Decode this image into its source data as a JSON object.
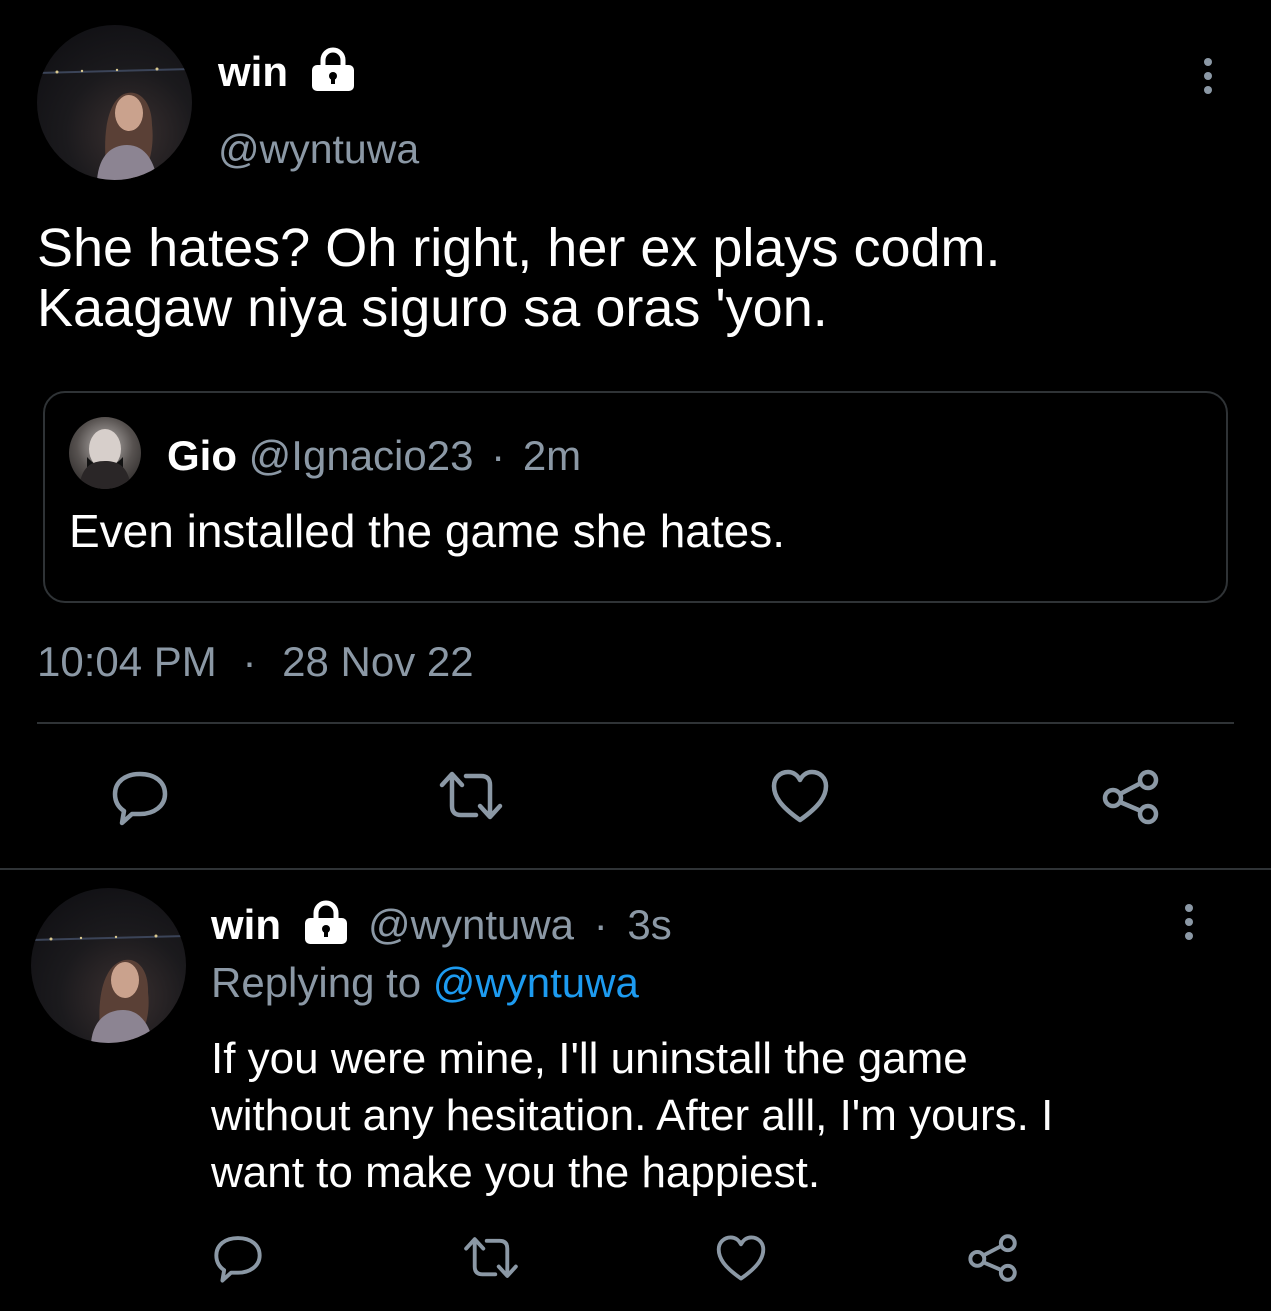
{
  "main_tweet": {
    "display_name": "win",
    "handle": "@wyntuwa",
    "text_line1": "She hates? Oh right, her ex plays codm.",
    "text_line2": "Kaagaw niya siguro sa oras 'yon.",
    "time": "10:04 PM",
    "separator": "·",
    "date": "28 Nov 22",
    "lock_icon": "lock-icon",
    "quoted": {
      "display_name": "Gio",
      "handle": "@Ignacio23",
      "separator": "·",
      "age": "2m",
      "text": "Even installed the game she hates."
    }
  },
  "reply_tweet": {
    "display_name": "win",
    "handle": "@wyntuwa",
    "separator": "·",
    "age": "3s",
    "replying_prefix": "Replying to",
    "replying_handle": "@wyntuwa",
    "text_line1": "If you were mine, I'll uninstall the game",
    "text_line2": "without any hesitation. After alll, I'm yours. I",
    "text_line3": "want to make you the happiest."
  },
  "actions": [
    "reply-icon",
    "retweet-icon",
    "like-icon",
    "share-icon"
  ],
  "colors": {
    "background": "#000000",
    "text": "#ffffff",
    "muted": "#8b98a5",
    "link": "#1d9bf0",
    "border": "#2f3336"
  }
}
